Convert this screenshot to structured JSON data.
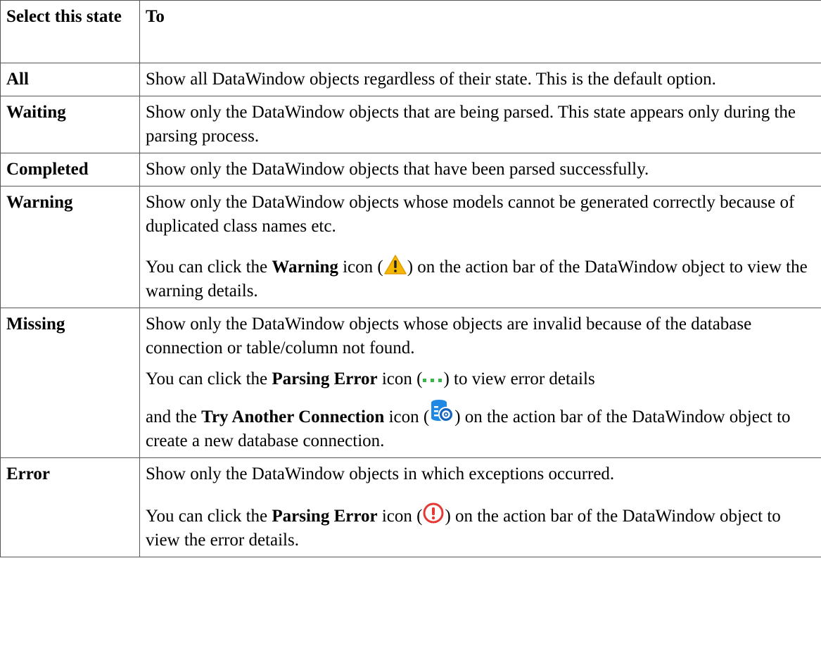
{
  "header": {
    "col1": "Select this state",
    "col2": "To"
  },
  "rows": [
    {
      "state": "All",
      "desc": "Show all DataWindow objects regardless of their state. This is the default option."
    },
    {
      "state": "Waiting",
      "desc": "Show only the DataWindow objects that are being parsed. This state appears only during the parsing process."
    },
    {
      "state": "Completed",
      "desc": "Show only the DataWindow objects that have been parsed successfully."
    },
    {
      "state": "Warning",
      "desc": "Show only the DataWindow objects whose models cannot be generated correctly because of duplicated class names etc.",
      "note_pre": "You can click the ",
      "note_bold": "Warning",
      "note_mid": " icon (",
      "note_post": ") on the action bar of the DataWindow object to view the warning details."
    },
    {
      "state": "Missing",
      "desc": "Show only the DataWindow objects whose objects are invalid because of the database connection or table/column not found.",
      "note1_pre": "You can click the ",
      "note1_bold": "Parsing Error",
      "note1_mid": " icon (",
      "note1_post": ") to view error details",
      "note2_pre": "and the ",
      "note2_bold": "Try Another Connection",
      "note2_mid": " icon (",
      "note2_post": ") on the action bar of the DataWindow object to create a new database connection."
    },
    {
      "state": "Error",
      "desc": "Show only the DataWindow objects in which exceptions occurred.",
      "note_pre": "You can click the ",
      "note_bold": "Parsing Error",
      "note_mid": " icon (",
      "note_post": ") on the action bar of the DataWindow object to view the error details."
    }
  ],
  "icons": {
    "warning": "warning-triangle-icon",
    "parsing_missing": "green-dots-icon",
    "connection": "database-connection-icon",
    "parsing_error": "red-exclamation-circle-icon"
  },
  "colors": {
    "warning_fill": "#f5b800",
    "dots_green": "#39b54a",
    "database_blue": "#1e88e5",
    "error_red": "#e53935"
  }
}
